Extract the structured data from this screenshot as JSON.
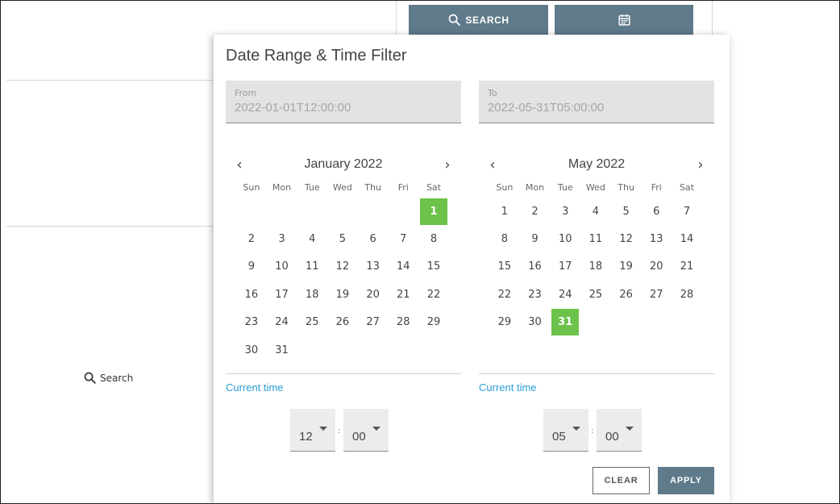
{
  "toolbar": {
    "search_label": "SEARCH"
  },
  "background": {
    "search_label": "Search"
  },
  "filter": {
    "title": "Date Range & Time Filter",
    "from": {
      "label": "From",
      "value": "2022-01-01T12:00:00"
    },
    "to": {
      "label": "To",
      "value": "2022-05-31T05:00:00"
    },
    "weekdays": [
      "Sun",
      "Mon",
      "Tue",
      "Wed",
      "Thu",
      "Fri",
      "Sat"
    ],
    "nav": {
      "prev": "‹",
      "next": "›"
    },
    "calendars": [
      {
        "month": "January 2022",
        "first_weekday": 6,
        "days": 31,
        "selected": 1
      },
      {
        "month": "May 2022",
        "first_weekday": 0,
        "days": 31,
        "selected": 31
      }
    ],
    "current_time_label": "Current time",
    "time_from": {
      "hour": "12",
      "minute": "00",
      "separator": ":"
    },
    "time_to": {
      "hour": "05",
      "minute": "00",
      "separator": ":"
    },
    "clear_label": "CLEAR",
    "apply_label": "APPLY"
  },
  "colors": {
    "accent": "#5f7a8a",
    "selected_day": "#6cc24a",
    "link": "#2a9fd6"
  }
}
